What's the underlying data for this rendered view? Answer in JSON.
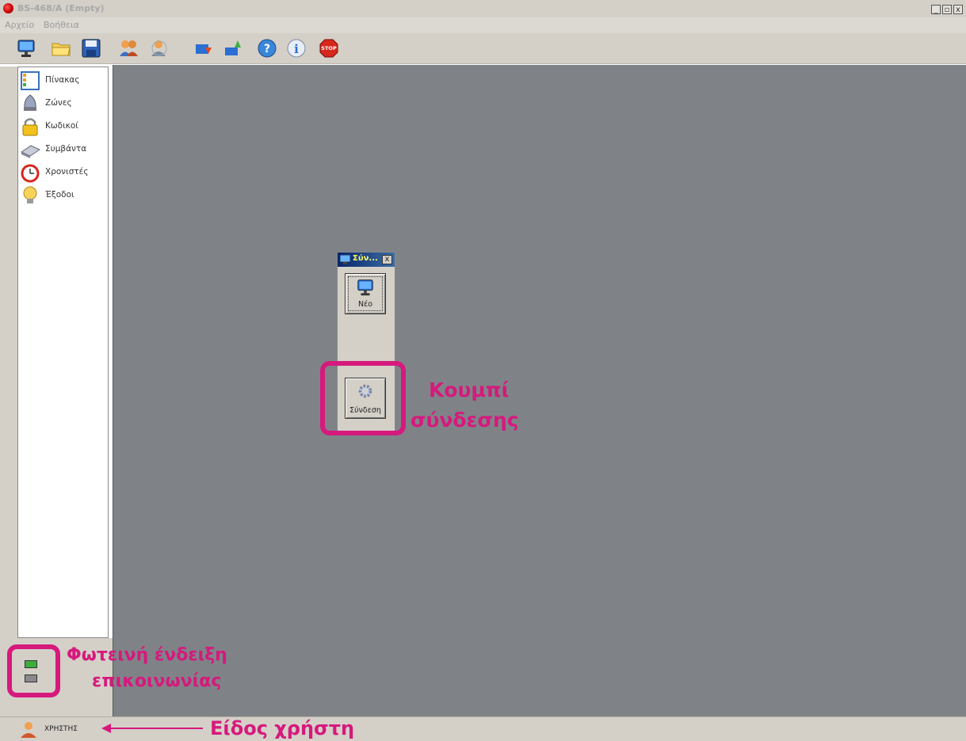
{
  "window": {
    "title": "BS-468/A (Empty)",
    "buttons": [
      "_",
      "▫",
      "x"
    ]
  },
  "menu": {
    "items": [
      "Αρχείο",
      "Βοήθεια"
    ]
  },
  "toolbar": {
    "icons": [
      "monitor-icon",
      "folder-icon",
      "save-icon",
      "users-icon",
      "user-dropdown-icon",
      "download-icon",
      "upload-icon",
      "help-icon",
      "info-icon",
      "stop-icon"
    ],
    "stop_label": "STOP"
  },
  "sidebar": {
    "items": [
      {
        "label": "Πίνακας",
        "icon": "panel-icon"
      },
      {
        "label": "Ζώνες",
        "icon": "zones-icon"
      },
      {
        "label": "Κωδικοί",
        "icon": "lock-icon"
      },
      {
        "label": "Συμβάντα",
        "icon": "events-icon"
      },
      {
        "label": "Χρονιστές",
        "icon": "alarm-clock-icon"
      },
      {
        "label": "Έξοδοι",
        "icon": "lightbulb-icon"
      }
    ]
  },
  "panel": {
    "title": "Σύν...",
    "close_label": "x",
    "new_button_label": "Νέο",
    "connect_button_label": "Σύνδεση"
  },
  "annotations": {
    "connect_line1": "Κουμπί",
    "connect_line2": "σύνδεσης",
    "led_line1": "Φωτεινή ένδειξη",
    "led_line2": "επικοινωνίας",
    "user_type": "Είδος χρήστη"
  },
  "status": {
    "user_label": "ΧΡΗΣΤΗΣ"
  },
  "colors": {
    "accent": "#d6197d",
    "workspace": "#7f8388",
    "chrome": "#d4d0c8"
  }
}
